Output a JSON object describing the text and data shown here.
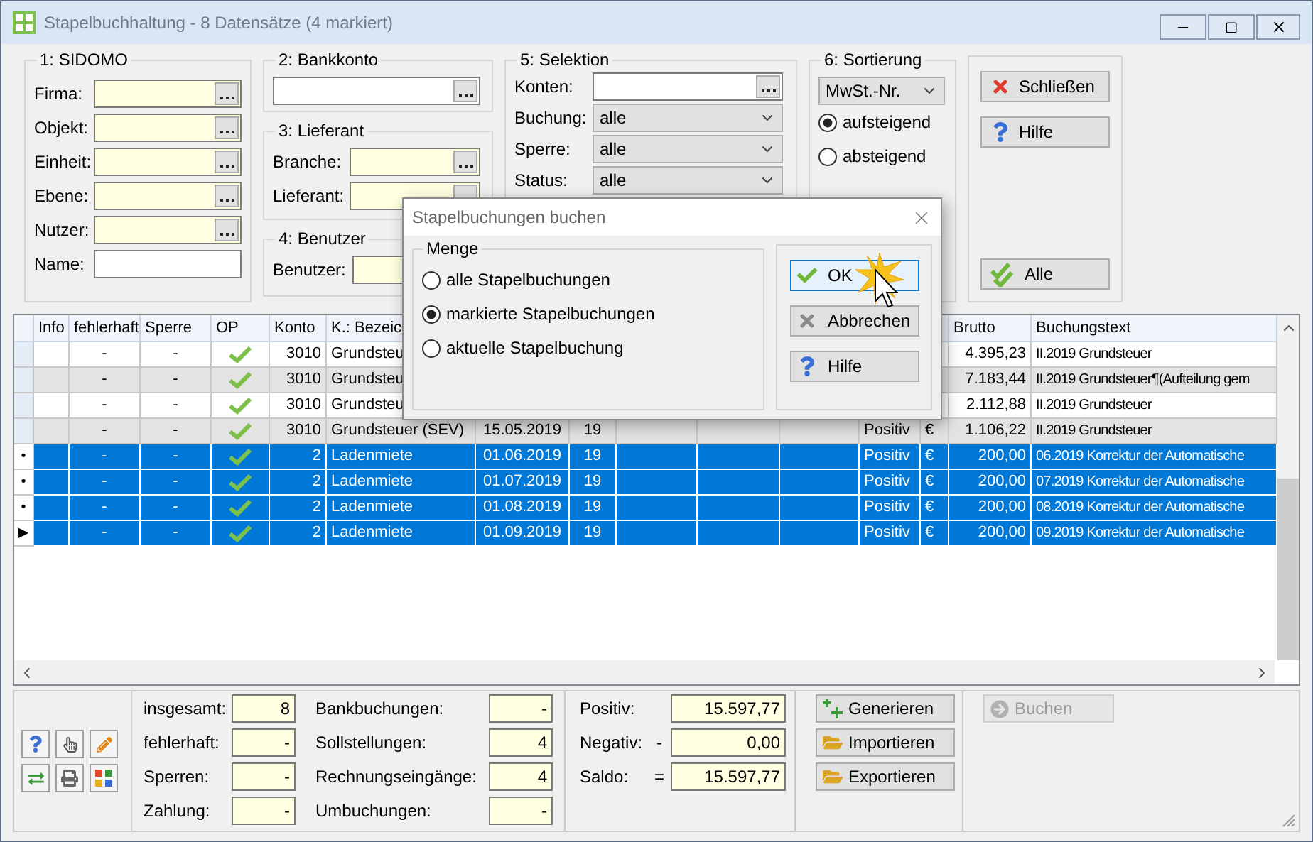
{
  "window": {
    "title": "Stapelbuchhaltung - 8 Datensätze (4 markiert)"
  },
  "sidomo": {
    "title": "1: SIDOMO",
    "fields": [
      {
        "label": "Firma:",
        "kind": "lookup",
        "highlighted": true
      },
      {
        "label": "Objekt:",
        "kind": "lookup",
        "highlighted": true
      },
      {
        "label": "Einheit:",
        "kind": "lookup",
        "highlighted": true
      },
      {
        "label": "Ebene:",
        "kind": "lookup",
        "highlighted": true
      },
      {
        "label": "Nutzer:",
        "kind": "lookup",
        "highlighted": true
      },
      {
        "label": "Name:",
        "kind": "text",
        "highlighted": false
      }
    ]
  },
  "bankkonto": {
    "title": "2: Bankkonto",
    "fields": [
      {
        "kind": "lookup",
        "highlighted": false
      }
    ]
  },
  "lieferant": {
    "title": "3: Lieferant",
    "fields": [
      {
        "label": "Branche:",
        "kind": "lookup",
        "highlighted": true
      },
      {
        "label": "Lieferant:",
        "kind": "lookup",
        "highlighted": true
      }
    ]
  },
  "benutzer": {
    "title": "4: Benutzer",
    "fields": [
      {
        "label": "Benutzer:",
        "kind": "text",
        "highlighted": true
      }
    ]
  },
  "selektion": {
    "title": "5: Selektion",
    "fields": [
      {
        "label": "Konten:",
        "kind": "lookup",
        "highlighted": false
      },
      {
        "label": "Buchung:",
        "kind": "select",
        "value": "alle"
      },
      {
        "label": "Sperre:",
        "kind": "select",
        "value": "alle"
      },
      {
        "label": "Status:",
        "kind": "select",
        "value": "alle"
      }
    ]
  },
  "sortierung": {
    "title": "6: Sortierung",
    "select": {
      "value": "MwSt.-Nr."
    },
    "options": [
      {
        "label": "aufsteigend",
        "selected": true
      },
      {
        "label": "absteigend",
        "selected": false
      }
    ]
  },
  "buttons": [
    {
      "label": "Schließen",
      "kind": "close"
    },
    {
      "label": "Hilfe",
      "kind": "help"
    },
    {
      "label": "Alle",
      "kind": "all"
    }
  ],
  "table": {
    "columns": [
      "Info",
      "fehlerhaft",
      "Sperre",
      "OP",
      "Konto",
      "K.: Bezeic"
    ],
    "columns_right": [
      "Brutto",
      "Buchungstext"
    ],
    "rows": [
      {
        "selected": false,
        "fehlerhaft": "-",
        "sperre": "-",
        "op": true,
        "konto": "3010",
        "bezeichnung": "Grundsteu",
        "brutto": "4.395,23",
        "buchungstext": "II.2019 Grundsteuer"
      },
      {
        "selected": false,
        "fehlerhaft": "-",
        "sperre": "-",
        "op": true,
        "konto": "3010",
        "bezeichnung": "Grundsteu",
        "brutto": "7.183,44",
        "buchungstext": "II.2019 Grundsteuer¶(Aufteilung gem"
      },
      {
        "selected": false,
        "fehlerhaft": "-",
        "sperre": "-",
        "op": true,
        "konto": "3010",
        "bezeichnung": "Grundsteu",
        "brutto": "2.112,88",
        "buchungstext": "II.2019 Grundsteuer"
      },
      {
        "selected": false,
        "fehlerhaft": "-",
        "sperre": "-",
        "op": true,
        "konto": "3010",
        "bezeichnung": "Grundsteuer (SEV)",
        "datum": "15.05.2019",
        "column_8": "19",
        "vorzeichen": "Positiv",
        "waehrung": "€",
        "brutto": "1.106,22",
        "buchungstext": "II.2019 Grundsteuer"
      },
      {
        "selected": true,
        "marker": "•",
        "fehlerhaft": "-",
        "sperre": "-",
        "op": true,
        "konto": "2",
        "bezeichnung": "Ladenmiete",
        "datum": "01.06.2019",
        "column_8": "19",
        "vorzeichen": "Positiv",
        "waehrung": "€",
        "brutto": "200,00",
        "buchungstext": "06.2019 Korrektur der Automatische"
      },
      {
        "selected": true,
        "marker": "•",
        "fehlerhaft": "-",
        "sperre": "-",
        "op": true,
        "konto": "2",
        "bezeichnung": "Ladenmiete",
        "datum": "01.07.2019",
        "column_8": "19",
        "vorzeichen": "Positiv",
        "waehrung": "€",
        "brutto": "200,00",
        "buchungstext": "07.2019 Korrektur der Automatische"
      },
      {
        "selected": true,
        "marker": "•",
        "fehlerhaft": "-",
        "sperre": "-",
        "op": true,
        "konto": "2",
        "bezeichnung": "Ladenmiete",
        "datum": "01.08.2019",
        "column_8": "19",
        "vorzeichen": "Positiv",
        "waehrung": "€",
        "brutto": "200,00",
        "buchungstext": "08.2019 Korrektur der Automatische"
      },
      {
        "selected": true,
        "marker": "▶",
        "fehlerhaft": "-",
        "sperre": "-",
        "op": true,
        "konto": "2",
        "bezeichnung": "Ladenmiete",
        "datum": "01.09.2019",
        "column_8": "19",
        "vorzeichen": "Positiv",
        "waehrung": "€",
        "brutto": "200,00",
        "buchungstext": "09.2019 Korrektur der Automatische"
      }
    ]
  },
  "summary": {
    "counts": [
      {
        "label": "insgesamt:",
        "value": "8"
      },
      {
        "label": "fehlerhaft:",
        "value": "-"
      },
      {
        "label": "Sperren:",
        "value": "-"
      },
      {
        "label": "Zahlung:",
        "value": "-"
      }
    ],
    "bookings": [
      {
        "label": "Bankbuchungen:",
        "value": "-"
      },
      {
        "label": "Sollstellungen:",
        "value": "4"
      },
      {
        "label": "Rechnungseingänge:",
        "value": "4"
      },
      {
        "label": "Umbuchungen:",
        "value": "-"
      }
    ],
    "totals": [
      {
        "label": "Positiv:",
        "value": "15.597,77"
      },
      {
        "label": "Negativ:",
        "sign": "-",
        "value": "0,00"
      },
      {
        "label": "Saldo:",
        "sign": "=",
        "value": "15.597,77"
      }
    ]
  },
  "actions": [
    {
      "label": "Generieren",
      "kind": "generate"
    },
    {
      "label": "Importieren",
      "kind": "import"
    },
    {
      "label": "Exportieren",
      "kind": "export"
    }
  ],
  "book_button": {
    "label": "Buchen",
    "disabled": true
  },
  "dialog": {
    "title": "Stapelbuchungen buchen",
    "group": "Menge",
    "options": [
      {
        "label": "alle Stapelbuchungen",
        "selected": false
      },
      {
        "label": "markierte Stapelbuchungen",
        "selected": true
      },
      {
        "label": "aktuelle Stapelbuchung",
        "selected": false
      }
    ],
    "buttons": [
      {
        "label": "OK",
        "kind": "ok",
        "focused": true
      },
      {
        "label": "Abbrechen",
        "kind": "cancel",
        "focused": false
      },
      {
        "label": "Hilfe",
        "kind": "help",
        "focused": false
      }
    ]
  }
}
